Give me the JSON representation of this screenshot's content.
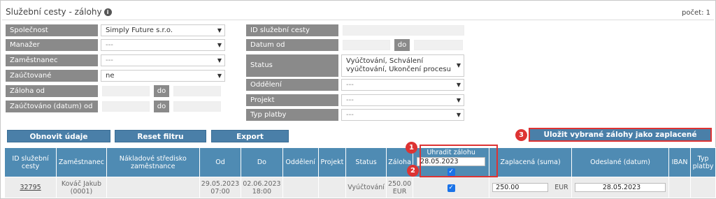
{
  "title": "Služební cesty - zálohy",
  "count_label": "počet: 1",
  "filters_left": [
    {
      "label": "Společnost",
      "value": "Simply Future s.r.o.",
      "type": "select",
      "dim": false
    },
    {
      "label": "Manažer",
      "value": "---",
      "type": "select",
      "dim": true
    },
    {
      "label": "Zaměstnanec",
      "value": "---",
      "type": "select",
      "dim": true
    },
    {
      "label": "Zaúčtované",
      "value": "ne",
      "type": "select",
      "dim": false
    },
    {
      "label": "Záloha od",
      "type": "range",
      "mid": "do"
    },
    {
      "label": "Zaúčtováno (datum) od",
      "type": "range",
      "mid": "do"
    }
  ],
  "filters_right": {
    "id_label": "ID služební cesty",
    "date_label": "Datum od",
    "date_mid": "do",
    "status_label": "Status",
    "status_value": "Vyúčtování, Schválení vyúčtování, Ukončení procesu",
    "dept_label": "Oddělení",
    "dept_value": "---",
    "project_label": "Projekt",
    "project_value": "---",
    "paytype_label": "Typ platby",
    "paytype_value": "---"
  },
  "buttons": {
    "refresh": "Obnovit údaje",
    "reset": "Reset filtru",
    "export": "Export",
    "save": "Uložit vybrané zálohy jako zaplacené"
  },
  "table": {
    "headers": [
      "ID služební cesty",
      "Zaměstnanec",
      "Nákladové středisko zaměstnance",
      "Od",
      "Do",
      "Oddělení",
      "Projekt",
      "Status",
      "Záloha",
      "Uhradit zálohu",
      "Zaplacená (suma)",
      "Odeslané (datum)",
      "IBAN",
      "Typ platby"
    ],
    "pay_date": "28.05.2023",
    "row": {
      "id": "32795",
      "employee": "Kováč Jakub (0001)",
      "cost_center": "",
      "from": "29.05.2023 07:00",
      "to": "02.06.2023 18:00",
      "dept": "",
      "project": "",
      "status": "Vyúčtování",
      "advance": "250.00 EUR",
      "paid_sum": "250.00",
      "currency": "EUR",
      "sent_date": "28.05.2023",
      "iban": "",
      "paytype": ""
    }
  },
  "badges": [
    "1",
    "2",
    "3"
  ],
  "colors": {
    "header_blue": "#4f8bb3",
    "button_blue": "#4a7fa8",
    "label_grey": "#8a8a8a",
    "highlight_red": "#d33333"
  }
}
